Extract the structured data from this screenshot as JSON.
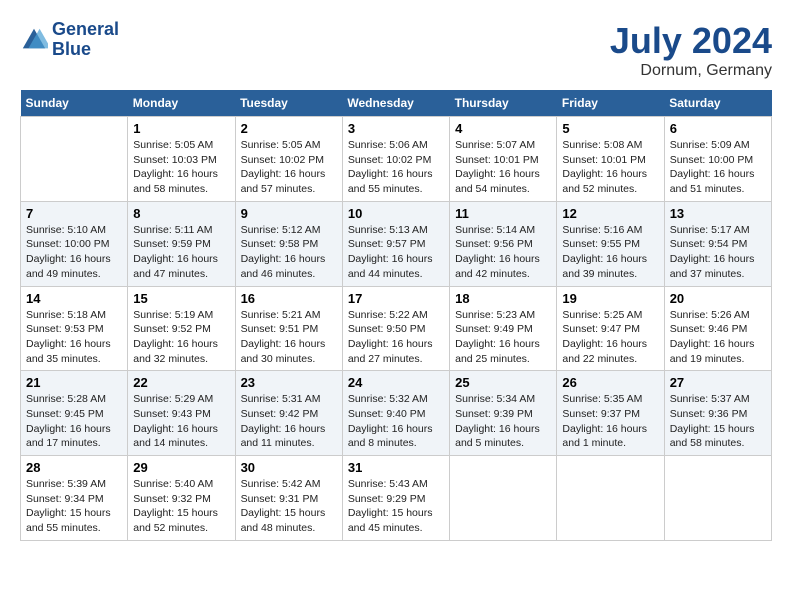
{
  "header": {
    "logo_line1": "General",
    "logo_line2": "Blue",
    "month_year": "July 2024",
    "location": "Dornum, Germany"
  },
  "columns": [
    "Sunday",
    "Monday",
    "Tuesday",
    "Wednesday",
    "Thursday",
    "Friday",
    "Saturday"
  ],
  "weeks": [
    [
      {
        "day": "",
        "sunrise": "",
        "sunset": "",
        "daylight": ""
      },
      {
        "day": "1",
        "sunrise": "Sunrise: 5:05 AM",
        "sunset": "Sunset: 10:03 PM",
        "daylight": "Daylight: 16 hours and 58 minutes."
      },
      {
        "day": "2",
        "sunrise": "Sunrise: 5:05 AM",
        "sunset": "Sunset: 10:02 PM",
        "daylight": "Daylight: 16 hours and 57 minutes."
      },
      {
        "day": "3",
        "sunrise": "Sunrise: 5:06 AM",
        "sunset": "Sunset: 10:02 PM",
        "daylight": "Daylight: 16 hours and 55 minutes."
      },
      {
        "day": "4",
        "sunrise": "Sunrise: 5:07 AM",
        "sunset": "Sunset: 10:01 PM",
        "daylight": "Daylight: 16 hours and 54 minutes."
      },
      {
        "day": "5",
        "sunrise": "Sunrise: 5:08 AM",
        "sunset": "Sunset: 10:01 PM",
        "daylight": "Daylight: 16 hours and 52 minutes."
      },
      {
        "day": "6",
        "sunrise": "Sunrise: 5:09 AM",
        "sunset": "Sunset: 10:00 PM",
        "daylight": "Daylight: 16 hours and 51 minutes."
      }
    ],
    [
      {
        "day": "7",
        "sunrise": "Sunrise: 5:10 AM",
        "sunset": "Sunset: 10:00 PM",
        "daylight": "Daylight: 16 hours and 49 minutes."
      },
      {
        "day": "8",
        "sunrise": "Sunrise: 5:11 AM",
        "sunset": "Sunset: 9:59 PM",
        "daylight": "Daylight: 16 hours and 47 minutes."
      },
      {
        "day": "9",
        "sunrise": "Sunrise: 5:12 AM",
        "sunset": "Sunset: 9:58 PM",
        "daylight": "Daylight: 16 hours and 46 minutes."
      },
      {
        "day": "10",
        "sunrise": "Sunrise: 5:13 AM",
        "sunset": "Sunset: 9:57 PM",
        "daylight": "Daylight: 16 hours and 44 minutes."
      },
      {
        "day": "11",
        "sunrise": "Sunrise: 5:14 AM",
        "sunset": "Sunset: 9:56 PM",
        "daylight": "Daylight: 16 hours and 42 minutes."
      },
      {
        "day": "12",
        "sunrise": "Sunrise: 5:16 AM",
        "sunset": "Sunset: 9:55 PM",
        "daylight": "Daylight: 16 hours and 39 minutes."
      },
      {
        "day": "13",
        "sunrise": "Sunrise: 5:17 AM",
        "sunset": "Sunset: 9:54 PM",
        "daylight": "Daylight: 16 hours and 37 minutes."
      }
    ],
    [
      {
        "day": "14",
        "sunrise": "Sunrise: 5:18 AM",
        "sunset": "Sunset: 9:53 PM",
        "daylight": "Daylight: 16 hours and 35 minutes."
      },
      {
        "day": "15",
        "sunrise": "Sunrise: 5:19 AM",
        "sunset": "Sunset: 9:52 PM",
        "daylight": "Daylight: 16 hours and 32 minutes."
      },
      {
        "day": "16",
        "sunrise": "Sunrise: 5:21 AM",
        "sunset": "Sunset: 9:51 PM",
        "daylight": "Daylight: 16 hours and 30 minutes."
      },
      {
        "day": "17",
        "sunrise": "Sunrise: 5:22 AM",
        "sunset": "Sunset: 9:50 PM",
        "daylight": "Daylight: 16 hours and 27 minutes."
      },
      {
        "day": "18",
        "sunrise": "Sunrise: 5:23 AM",
        "sunset": "Sunset: 9:49 PM",
        "daylight": "Daylight: 16 hours and 25 minutes."
      },
      {
        "day": "19",
        "sunrise": "Sunrise: 5:25 AM",
        "sunset": "Sunset: 9:47 PM",
        "daylight": "Daylight: 16 hours and 22 minutes."
      },
      {
        "day": "20",
        "sunrise": "Sunrise: 5:26 AM",
        "sunset": "Sunset: 9:46 PM",
        "daylight": "Daylight: 16 hours and 19 minutes."
      }
    ],
    [
      {
        "day": "21",
        "sunrise": "Sunrise: 5:28 AM",
        "sunset": "Sunset: 9:45 PM",
        "daylight": "Daylight: 16 hours and 17 minutes."
      },
      {
        "day": "22",
        "sunrise": "Sunrise: 5:29 AM",
        "sunset": "Sunset: 9:43 PM",
        "daylight": "Daylight: 16 hours and 14 minutes."
      },
      {
        "day": "23",
        "sunrise": "Sunrise: 5:31 AM",
        "sunset": "Sunset: 9:42 PM",
        "daylight": "Daylight: 16 hours and 11 minutes."
      },
      {
        "day": "24",
        "sunrise": "Sunrise: 5:32 AM",
        "sunset": "Sunset: 9:40 PM",
        "daylight": "Daylight: 16 hours and 8 minutes."
      },
      {
        "day": "25",
        "sunrise": "Sunrise: 5:34 AM",
        "sunset": "Sunset: 9:39 PM",
        "daylight": "Daylight: 16 hours and 5 minutes."
      },
      {
        "day": "26",
        "sunrise": "Sunrise: 5:35 AM",
        "sunset": "Sunset: 9:37 PM",
        "daylight": "Daylight: 16 hours and 1 minute."
      },
      {
        "day": "27",
        "sunrise": "Sunrise: 5:37 AM",
        "sunset": "Sunset: 9:36 PM",
        "daylight": "Daylight: 15 hours and 58 minutes."
      }
    ],
    [
      {
        "day": "28",
        "sunrise": "Sunrise: 5:39 AM",
        "sunset": "Sunset: 9:34 PM",
        "daylight": "Daylight: 15 hours and 55 minutes."
      },
      {
        "day": "29",
        "sunrise": "Sunrise: 5:40 AM",
        "sunset": "Sunset: 9:32 PM",
        "daylight": "Daylight: 15 hours and 52 minutes."
      },
      {
        "day": "30",
        "sunrise": "Sunrise: 5:42 AM",
        "sunset": "Sunset: 9:31 PM",
        "daylight": "Daylight: 15 hours and 48 minutes."
      },
      {
        "day": "31",
        "sunrise": "Sunrise: 5:43 AM",
        "sunset": "Sunset: 9:29 PM",
        "daylight": "Daylight: 15 hours and 45 minutes."
      },
      {
        "day": "",
        "sunrise": "",
        "sunset": "",
        "daylight": ""
      },
      {
        "day": "",
        "sunrise": "",
        "sunset": "",
        "daylight": ""
      },
      {
        "day": "",
        "sunrise": "",
        "sunset": "",
        "daylight": ""
      }
    ]
  ]
}
